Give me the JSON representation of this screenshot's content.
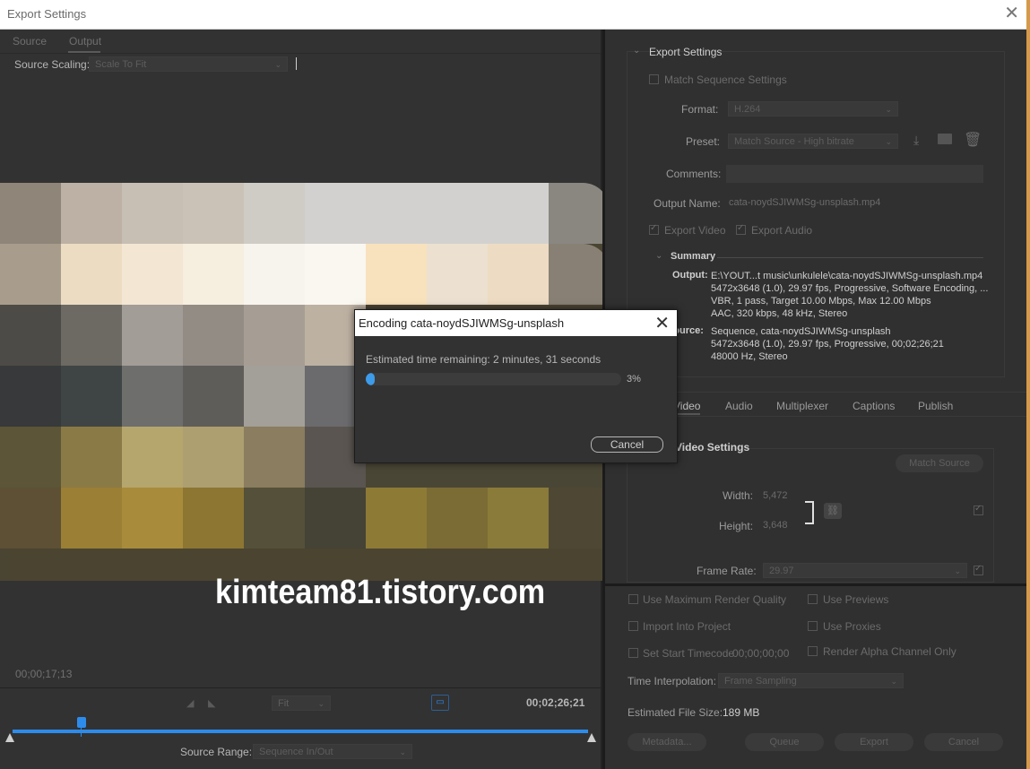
{
  "window": {
    "title": "Export Settings",
    "close_glyph": "✕"
  },
  "left": {
    "tabs": [
      "Source",
      "Output"
    ],
    "source_scaling_label": "Source Scaling:",
    "source_scaling_value": "Scale To Fit",
    "watermark": "kimteam81.tistory.com",
    "timecode_current": "00;00;17;13",
    "timecode_total": "00;02;26;21",
    "fit_value": "Fit",
    "source_range_label": "Source Range:",
    "source_range_value": "Sequence In/Out",
    "playhead_fraction": 0.118
  },
  "export_settings": {
    "heading": "Export Settings",
    "match_sequence": "Match Sequence Settings",
    "format_label": "Format:",
    "format_value": "H.264",
    "preset_label": "Preset:",
    "preset_value": "Match Source - High bitrate",
    "comments_label": "Comments:",
    "output_name_label": "Output Name:",
    "output_name_value": "cata-noydSJIWMSg-unsplash.mp4",
    "export_video": "Export Video",
    "export_audio": "Export Audio",
    "summary_heading": "Summary",
    "output_label": "Output:",
    "output_lines": [
      "E:\\YOUT...t music\\unkulele\\cata-noydSJIWMSg-unsplash.mp4",
      "5472x3648 (1.0), 29.97 fps, Progressive, Software Encoding, ...",
      "VBR, 1 pass, Target 10.00 Mbps, Max 12.00 Mbps",
      "AAC, 320 kbps, 48 kHz, Stereo"
    ],
    "source_label": "Source:",
    "source_lines": [
      "Sequence, cata-noydSJIWMSg-unsplash",
      "5472x3648 (1.0), 29.97 fps, Progressive, 00;02;26;21",
      "48000 Hz, Stereo"
    ]
  },
  "settings_tabs": [
    "Video",
    "Audio",
    "Multiplexer",
    "Captions",
    "Publish"
  ],
  "video_settings": {
    "heading": "Video Settings",
    "match_source": "Match Source",
    "width_label": "Width:",
    "width_value": "5,472",
    "height_label": "Height:",
    "height_value": "3,648",
    "frame_rate_label": "Frame Rate:",
    "frame_rate_value": "29.97"
  },
  "bottom_options": {
    "max_render": "Use Maximum Render Quality",
    "use_previews": "Use Previews",
    "import_into_project": "Import Into Project",
    "use_proxies": "Use Proxies",
    "set_start_timecode": "Set Start Timecode",
    "start_timecode_value": "00;00;00;00",
    "render_alpha": "Render Alpha Channel Only",
    "time_interp_label": "Time Interpolation:",
    "time_interp_value": "Frame Sampling",
    "file_size_label": "Estimated File Size:",
    "file_size_value": "189 MB",
    "metadata": "Metadata...",
    "queue": "Queue",
    "export": "Export",
    "cancel": "Cancel"
  },
  "modal": {
    "title": "Encoding cata-noydSJIWMSg-unsplash",
    "estimated": "Estimated time remaining: 2 minutes, 31 seconds",
    "percent_text": "3%",
    "progress_fraction": 0.03,
    "cancel": "Cancel"
  },
  "colors": {
    "accent": "#2d8ceb"
  }
}
